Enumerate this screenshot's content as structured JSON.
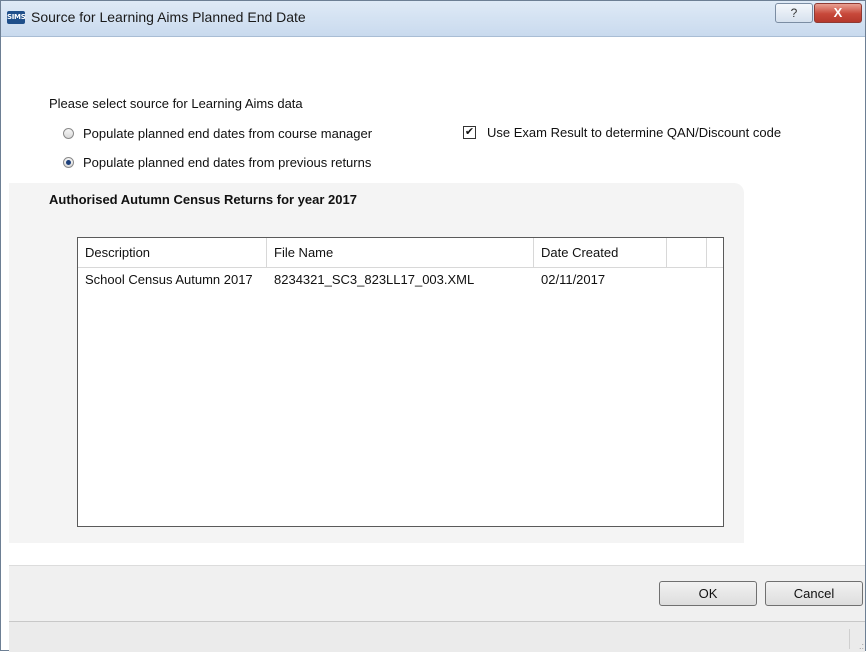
{
  "window": {
    "title": "Source for Learning Aims Planned End Date",
    "app_icon_text": "SIMS",
    "help_glyph": "?",
    "close_glyph": "X"
  },
  "form": {
    "prompt": "Please select source for Learning Aims data",
    "options": [
      {
        "label": "Populate planned end dates from course manager",
        "selected": false
      },
      {
        "label": "Populate planned end dates from previous returns",
        "selected": true
      }
    ],
    "exam_checkbox": {
      "label": "Use Exam Result to determine QAN/Discount code",
      "checked": true,
      "mark": "✔"
    }
  },
  "panel": {
    "title": "Authorised Autumn Census Returns for year 2017"
  },
  "table": {
    "columns": [
      "Description",
      "File Name",
      "Date Created"
    ],
    "rows": [
      [
        "School Census Autumn 2017",
        "8234321_SC3_823LL17_003.XML",
        "02/11/2017"
      ]
    ]
  },
  "buttons": {
    "ok": "OK",
    "cancel": "Cancel"
  },
  "statusbar": {
    "grip_glyph": ".:"
  }
}
